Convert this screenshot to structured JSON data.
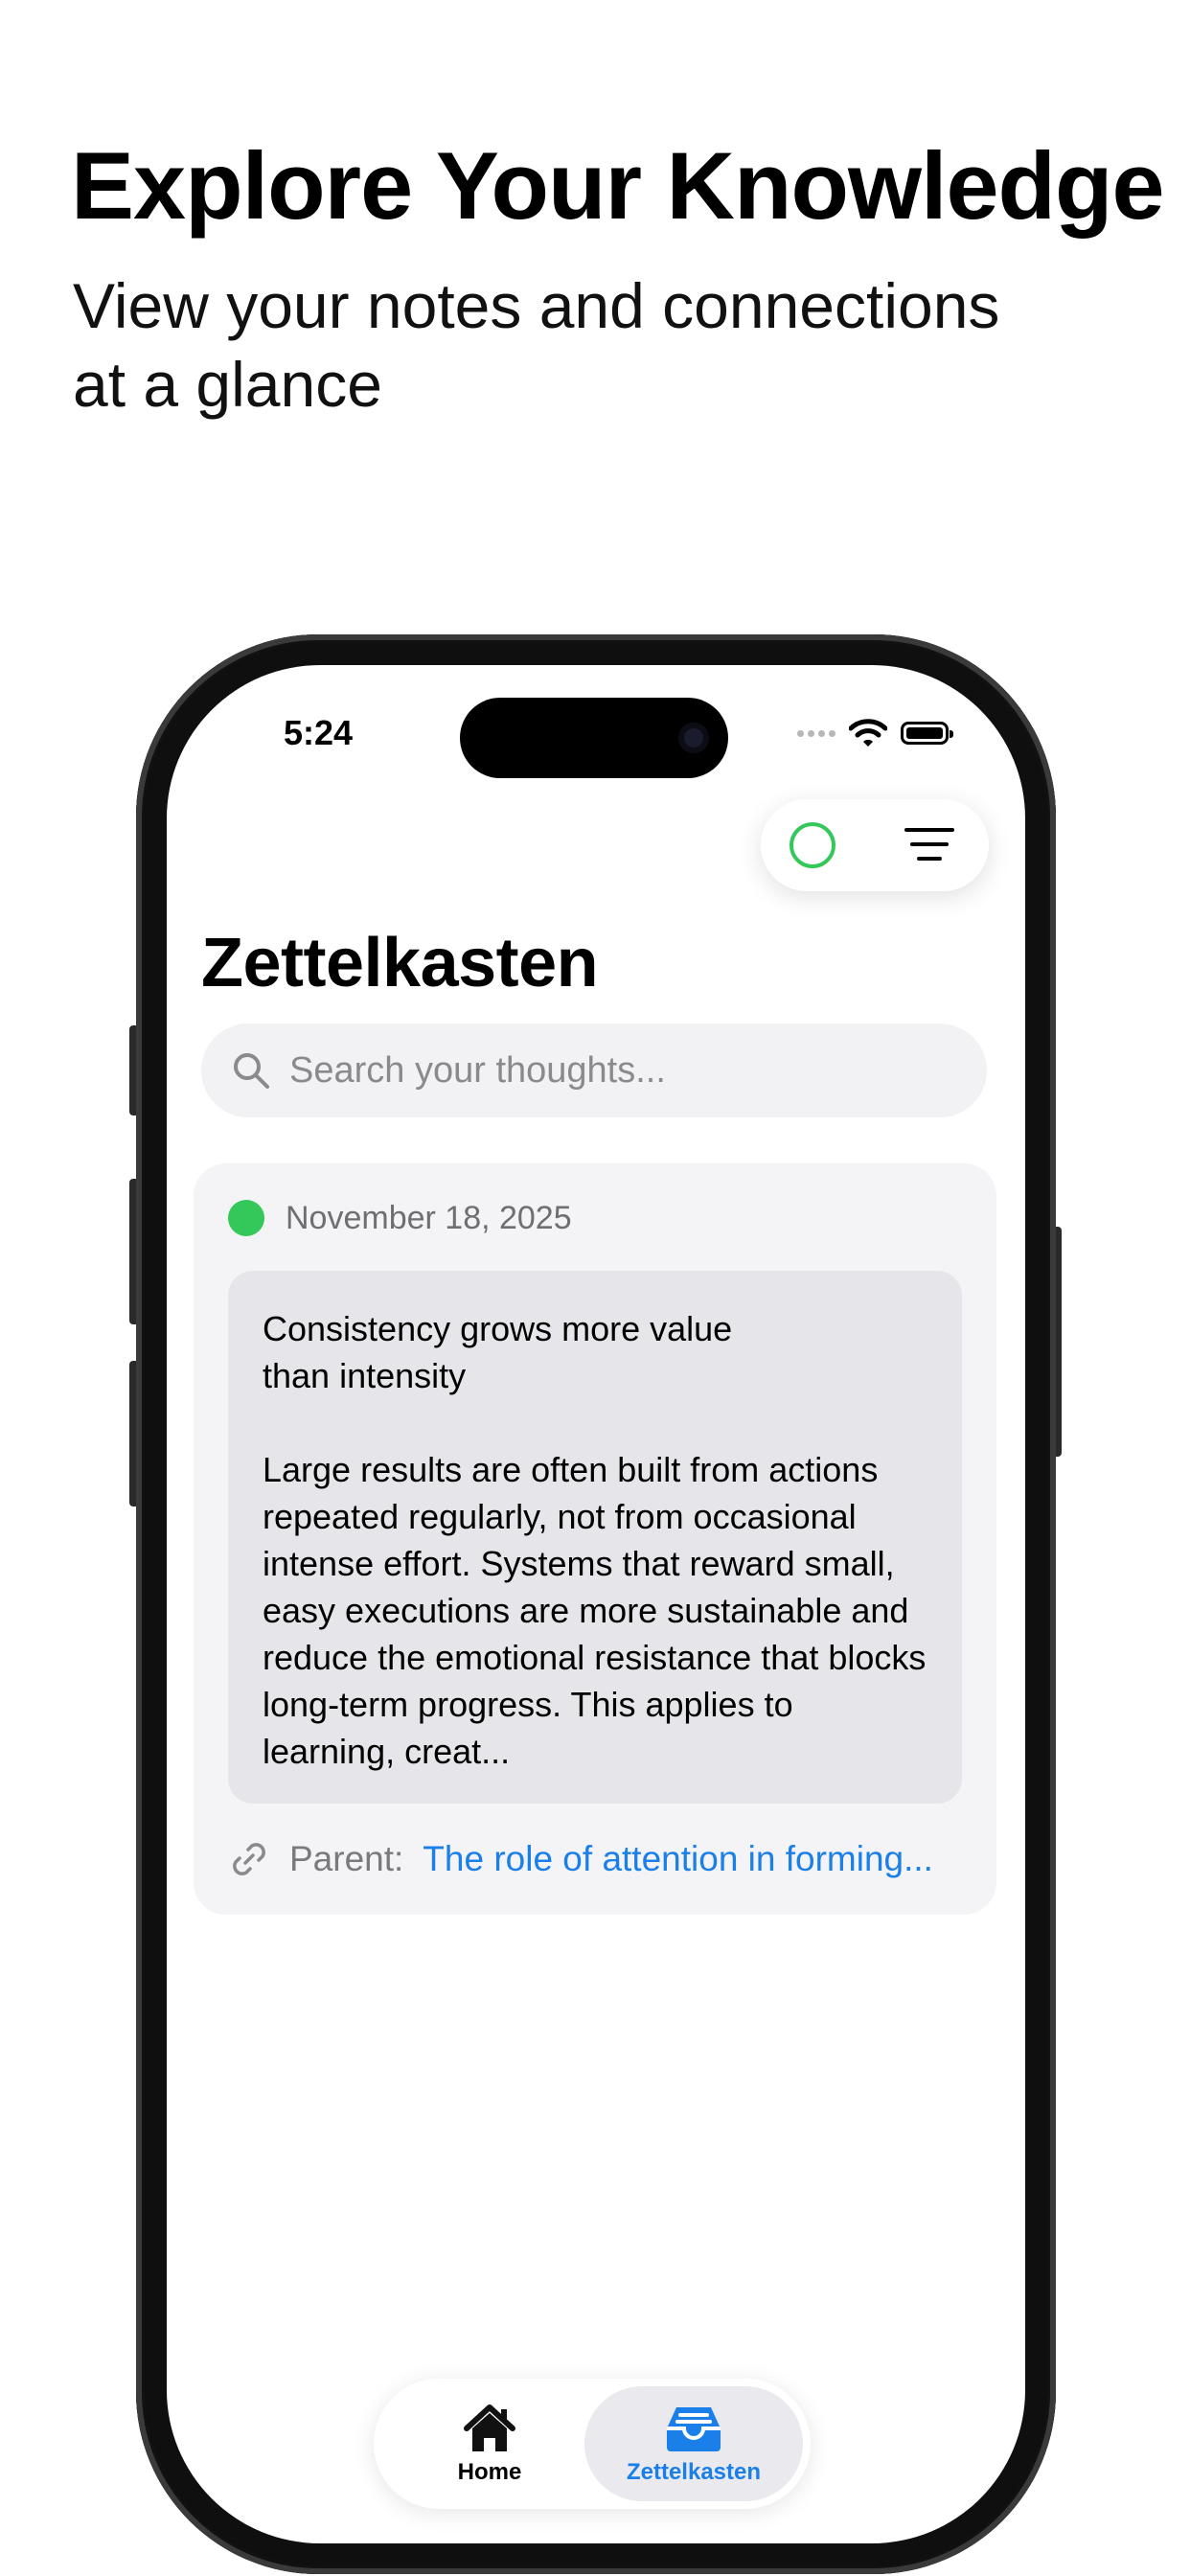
{
  "promo": {
    "title": "Explore Your Knowledge",
    "subtitle": "View your notes and connections at a glance"
  },
  "status_bar": {
    "time": "5:24"
  },
  "app": {
    "title": "Zettelkasten"
  },
  "search": {
    "placeholder": "Search your thoughts...",
    "value": ""
  },
  "note": {
    "date": "November 18, 2025",
    "status_color": "#34c759",
    "title": "Consistency grows more value than intensity",
    "body": "Large results are often built from actions repeated regularly, not from occasional intense effort. Systems that reward small, easy executions are more sustainable and reduce the emotional resistance that blocks long-term progress. This applies to learning, creat...",
    "parent_label": "Parent:",
    "parent_link": "The role of attention in forming..."
  },
  "tab_bar": {
    "tabs": [
      {
        "label": "Home",
        "icon": "home-icon",
        "selected": false
      },
      {
        "label": "Zettelkasten",
        "icon": "inbox-tray-icon",
        "selected": true
      }
    ]
  },
  "colors": {
    "accent": "#1a7fe8",
    "status_green": "#34c759"
  }
}
